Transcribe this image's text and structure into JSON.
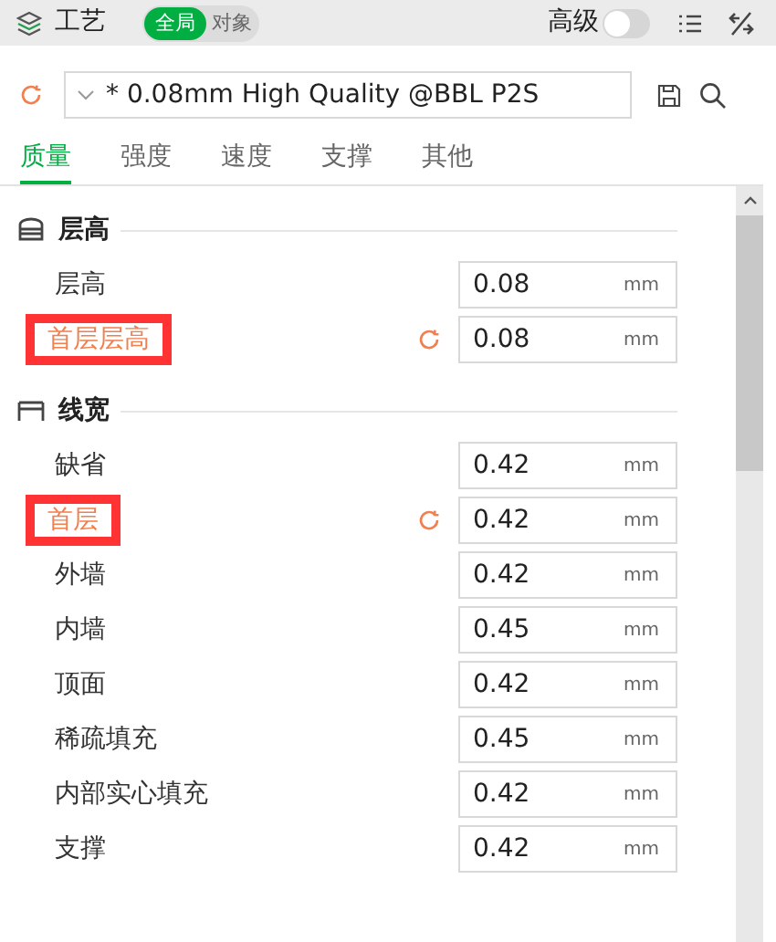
{
  "header": {
    "title": "工艺",
    "scope": [
      {
        "label": "全局",
        "selected": true
      },
      {
        "label": "对象",
        "selected": false
      }
    ],
    "advanced": {
      "label": "高级",
      "on": false
    }
  },
  "preset": {
    "value": "* 0.08mm High Quality @BBL P2S"
  },
  "tabs": [
    {
      "label": "质量",
      "selected": true
    },
    {
      "label": "强度",
      "selected": false
    },
    {
      "label": "速度",
      "selected": false
    },
    {
      "label": "支撑",
      "selected": false
    },
    {
      "label": "其他",
      "selected": false
    }
  ],
  "sections": [
    {
      "kind": "layers",
      "title": "层高",
      "rows": [
        {
          "label": "层高",
          "value": "0.08",
          "unit": "mm",
          "modified": false,
          "highlighted": false
        },
        {
          "label": "首层层高",
          "value": "0.08",
          "unit": "mm",
          "modified": true,
          "highlighted": true
        }
      ]
    },
    {
      "kind": "width",
      "title": "线宽",
      "rows": [
        {
          "label": "缺省",
          "value": "0.42",
          "unit": "mm",
          "modified": false,
          "highlighted": false
        },
        {
          "label": "首层",
          "value": "0.42",
          "unit": "mm",
          "modified": true,
          "highlighted": true
        },
        {
          "label": "外墙",
          "value": "0.42",
          "unit": "mm",
          "modified": false,
          "highlighted": false
        },
        {
          "label": "内墙",
          "value": "0.45",
          "unit": "mm",
          "modified": false,
          "highlighted": false
        },
        {
          "label": "顶面",
          "value": "0.42",
          "unit": "mm",
          "modified": false,
          "highlighted": false
        },
        {
          "label": "稀疏填充",
          "value": "0.45",
          "unit": "mm",
          "modified": false,
          "highlighted": false
        },
        {
          "label": "内部实心填充",
          "value": "0.42",
          "unit": "mm",
          "modified": false,
          "highlighted": false
        },
        {
          "label": "支撑",
          "value": "0.42",
          "unit": "mm",
          "modified": false,
          "highlighted": false
        }
      ]
    }
  ]
}
